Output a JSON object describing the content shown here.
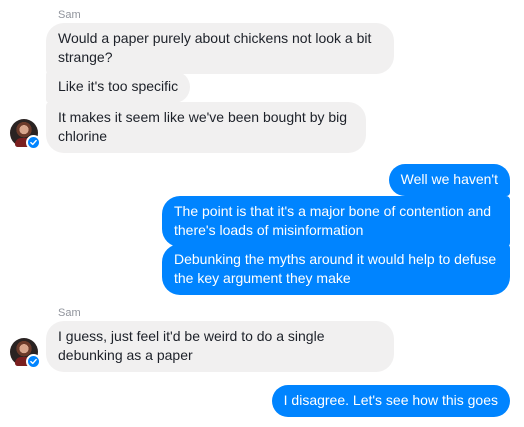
{
  "conversation": {
    "groups": [
      {
        "sender": "Sam",
        "messages": [
          "Would a paper purely about chickens not look a bit strange?",
          "Like it's too specific",
          "It makes it seem like we've been bought by big chlorine"
        ]
      },
      {
        "sender": "",
        "messages": [
          "Well we haven't",
          "The point is that it's a major bone of contention and there's loads of misinformation",
          "Debunking the myths around it would help to defuse the key argument they make"
        ]
      },
      {
        "sender": "Sam",
        "messages": [
          "I guess, just feel it'd be weird to do a single debunking as a paper"
        ]
      },
      {
        "sender": "",
        "messages": [
          "I disagree. Let's see how this goes"
        ]
      }
    ]
  },
  "icons": {
    "avatar": "user-avatar-photo",
    "verified_badge": "check-badge-icon"
  },
  "colors": {
    "incoming_bubble": "#f1f0f0",
    "outgoing_bubble": "#0084ff",
    "sender_name": "#90949c"
  }
}
